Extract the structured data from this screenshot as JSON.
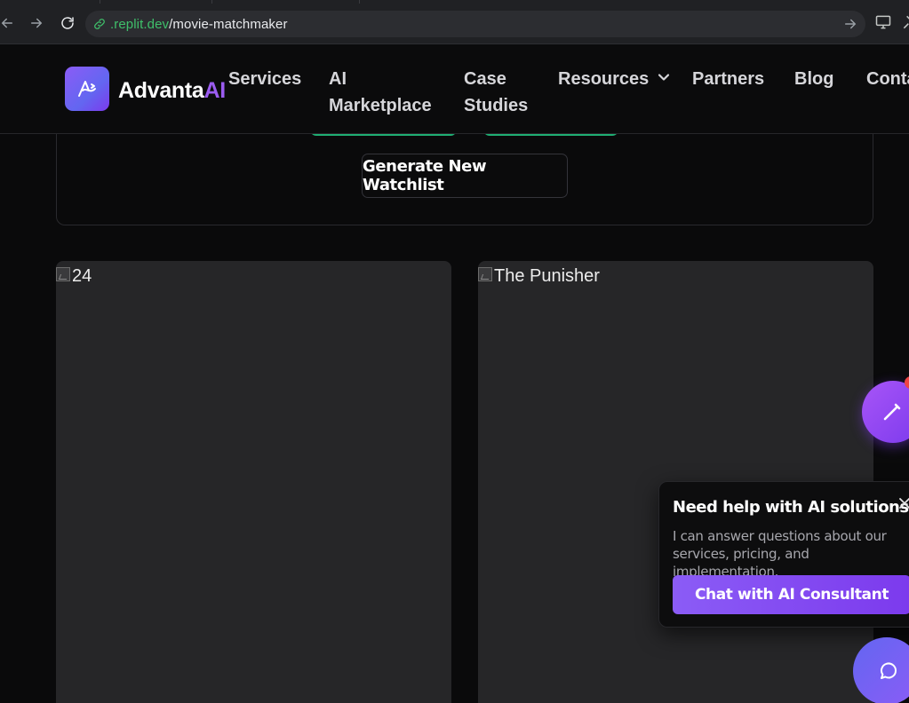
{
  "browser": {
    "url_host": ".replit.dev",
    "url_path": "/movie-matchmaker"
  },
  "site": {
    "brand_main": "Advanta",
    "brand_accent": "AI",
    "nav": {
      "services": "Services",
      "ai_marketplace_line1": "AI",
      "ai_marketplace_line2": "Marketplace",
      "case_studies_line1": "Case",
      "case_studies_line2": "Studies",
      "resources": "Resources",
      "partners": "Partners",
      "blog": "Blog",
      "contact": "Conta"
    }
  },
  "main": {
    "generate_button": "Generate New Watchlist",
    "movies": [
      {
        "alt": "24"
      },
      {
        "alt": "The Punisher"
      }
    ]
  },
  "chat_widget": {
    "title": "Need help with AI solutions?",
    "description": "I can answer questions about our services, pricing, and implementation.",
    "cta": "Chat with AI Consultant"
  },
  "colors": {
    "accent": "#8b5cf6",
    "url_host": "#3fbf6a",
    "page_bg": "#0a0a0b",
    "card_bg": "#262628"
  },
  "icons": [
    "back-arrow-icon",
    "forward-arrow-icon",
    "reload-icon",
    "link-icon",
    "go-arrow-icon",
    "monitor-icon",
    "logo-icon",
    "chevron-down-icon",
    "broken-image-icon",
    "pencil-icon",
    "close-icon",
    "chat-bubble-icon"
  ]
}
